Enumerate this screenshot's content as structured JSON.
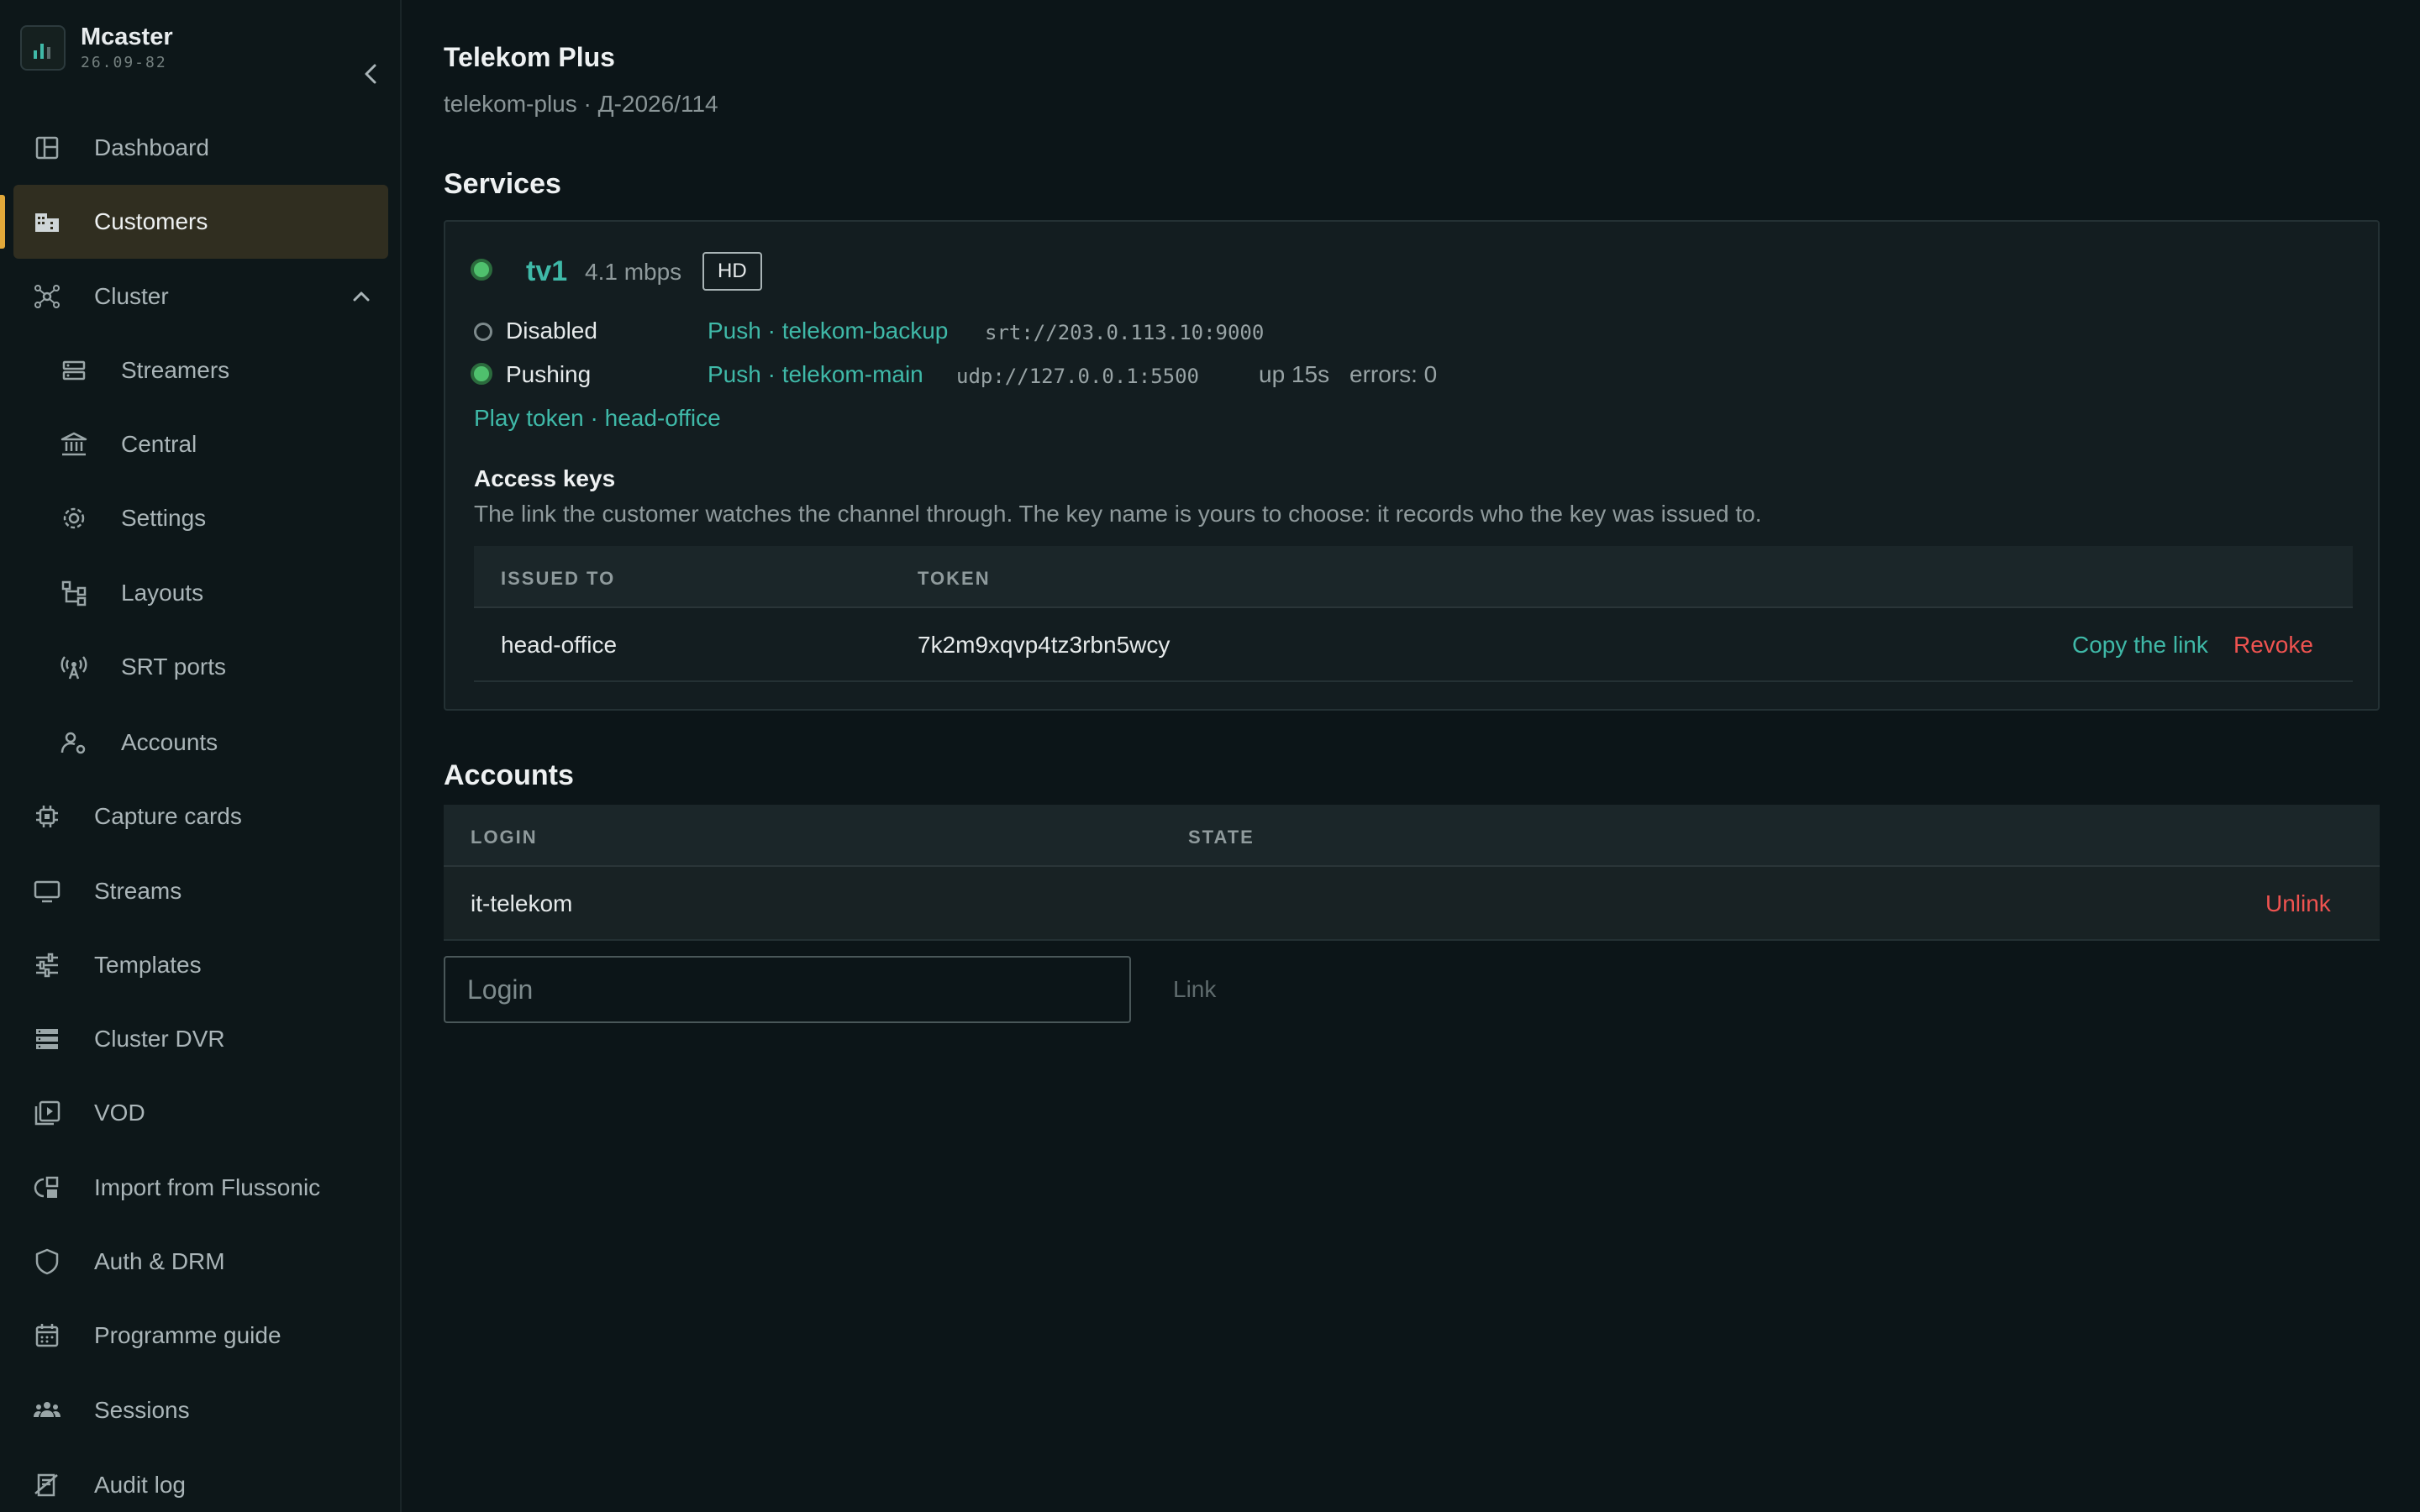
{
  "brand": {
    "name": "Mcaster",
    "version": "26.09-82"
  },
  "sidebar": {
    "items": [
      {
        "label": "Dashboard",
        "icon": "dashboard-icon"
      },
      {
        "label": "Customers",
        "icon": "building-icon",
        "active": true
      },
      {
        "label": "Cluster",
        "icon": "cluster-icon",
        "expanded": true
      },
      {
        "label": "Streamers",
        "icon": "server-icon",
        "sub": true
      },
      {
        "label": "Central",
        "icon": "bank-icon",
        "sub": true
      },
      {
        "label": "Settings",
        "icon": "gear-icon",
        "sub": true
      },
      {
        "label": "Layouts",
        "icon": "layouts-icon",
        "sub": true
      },
      {
        "label": "SRT ports",
        "icon": "antenna-icon",
        "sub": true
      },
      {
        "label": "Accounts",
        "icon": "user-gear-icon",
        "sub": true
      },
      {
        "label": "Capture cards",
        "icon": "chip-icon"
      },
      {
        "label": "Streams",
        "icon": "monitor-icon"
      },
      {
        "label": "Templates",
        "icon": "sliders-icon"
      },
      {
        "label": "Cluster DVR",
        "icon": "storage-icon"
      },
      {
        "label": "VOD",
        "icon": "video-library-icon"
      },
      {
        "label": "Import from Flussonic",
        "icon": "import-icon"
      },
      {
        "label": "Auth & DRM",
        "icon": "shield-icon"
      },
      {
        "label": "Programme guide",
        "icon": "calendar-icon"
      },
      {
        "label": "Sessions",
        "icon": "users-icon"
      },
      {
        "label": "Audit log",
        "icon": "audit-icon"
      }
    ]
  },
  "page": {
    "title": "Telekom Plus",
    "subtitle": "telekom-plus · Д-2026/114"
  },
  "services": {
    "heading": "Services",
    "service": {
      "name": "tv1",
      "rate": "4.1 mbps",
      "badge": "HD",
      "status_color": "#4fc06d",
      "pushes": [
        {
          "state": "Disabled",
          "target": "Push · telekom-backup",
          "url": "srt://203.0.113.10:9000",
          "uptime": "",
          "errors": ""
        },
        {
          "state": "Pushing",
          "target": "Push · telekom-main",
          "url": "udp://127.0.0.1:5500",
          "uptime": "up 15s",
          "errors": "errors: 0"
        }
      ],
      "play_token": "Play token · head-office"
    },
    "access_keys": {
      "title": "Access keys",
      "description": "The link the customer watches the channel through. The key name is yours to choose: it records who the key was issued to.",
      "columns": [
        "ISSUED TO",
        "TOKEN"
      ],
      "rows": [
        {
          "issued_to": "head-office",
          "token": "7k2m9xqvp4tz3rbn5wcy",
          "copy_label": "Copy the link",
          "revoke_label": "Revoke"
        }
      ]
    }
  },
  "accounts": {
    "heading": "Accounts",
    "columns": [
      "LOGIN",
      "STATE"
    ],
    "rows": [
      {
        "login": "it-telekom",
        "state": "",
        "unlink_label": "Unlink"
      }
    ],
    "login_placeholder": "Login",
    "link_label": "Link"
  },
  "colors": {
    "accent": "#3fb9a8",
    "active_marker": "#e2a93a",
    "danger": "#ef5350",
    "ok": "#4fc06d"
  }
}
